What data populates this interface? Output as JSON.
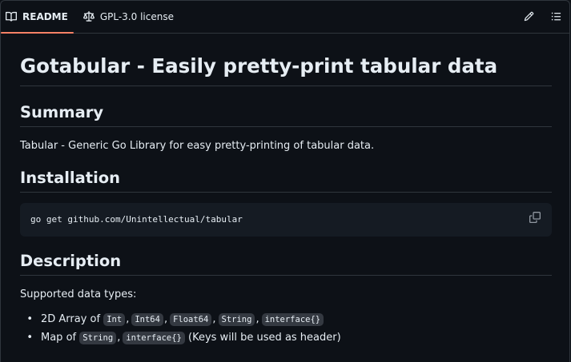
{
  "tabs": {
    "readme_label": "README",
    "license_label": "GPL-3.0 license"
  },
  "toolbar": {
    "edit_icon": "pencil-icon",
    "outline_icon": "list-unordered-icon"
  },
  "readme": {
    "title": "Gotabular - Easily pretty-print tabular data",
    "summary_heading": "Summary",
    "summary_text": "Tabular - Generic Go Library for easy pretty-printing of tabular data.",
    "installation_heading": "Installation",
    "install_command": "go get github.com/Unintellectual/tabular",
    "description_heading": "Description",
    "description_text": "Supported data types:",
    "list": {
      "item1_prefix": "2D Array of",
      "item1_types": [
        "Int",
        "Int64",
        "Float64",
        "String",
        "interface{}"
      ],
      "item2_prefix": "Map of",
      "item2_types": [
        "String",
        "interface{}"
      ],
      "item2_suffix": "(Keys will be used as header)"
    }
  },
  "colors": {
    "background": "#0d1117",
    "border": "#30363d",
    "active_tab_underline": "#f78166",
    "code_background": "#151b23",
    "inline_code_background": "#343941"
  }
}
